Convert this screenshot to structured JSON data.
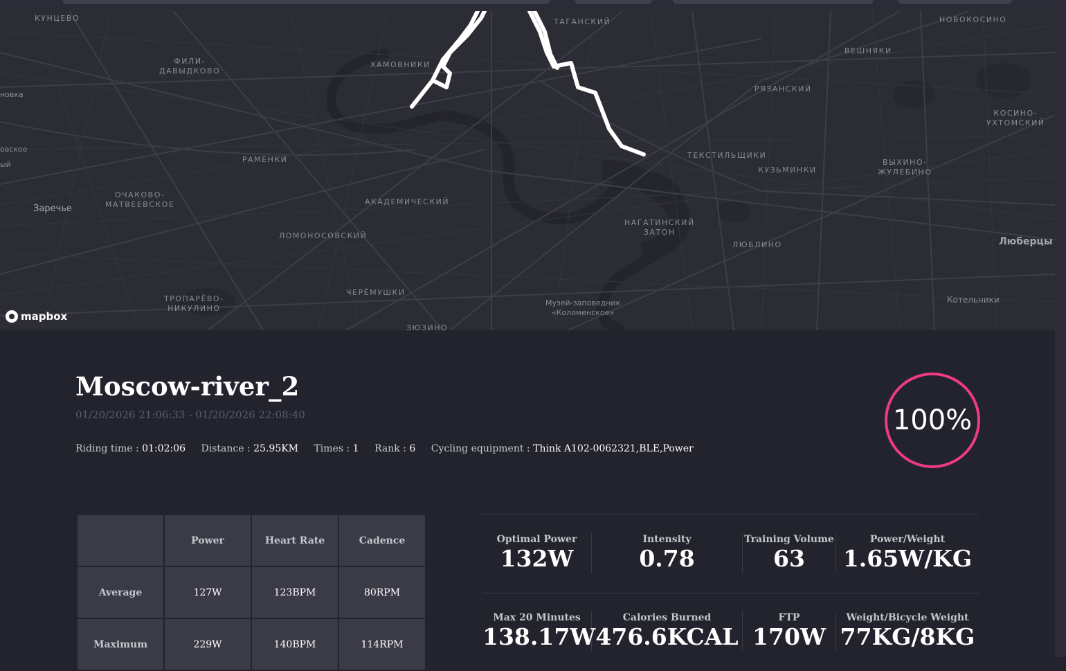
{
  "map": {
    "labels": [
      "КУНЦЕВО",
      "ФИЛИ-\nДАВЫДКОВО",
      "ХАМОВНИКИ",
      "ТАГАНСКИЙ",
      "НОВОКОСИНО",
      "ВЕШНЯКИ",
      "РЯЗАНСКИЙ",
      "КОСИНО-\nУХТОМСКИЙ",
      "ТЕКСТИЛЬЩИКИ",
      "КУЗЬМИНКИ",
      "ВЫХИНО-\nЖУЛЕБИНО",
      "РАМЕНКИ",
      "ОЧАКОВО-\nМАТВЕЕВСКОЕ",
      "Заречье",
      "АКАДЕМИЧЕСКИЙ",
      "ЛОМОНОСОВСКИЙ",
      "НАГАТИНСКИЙ\nЗАТОН",
      "ЛЮБЛИНО",
      "Люберцы",
      "ТРОПАРЁВО-\nНИКУЛИНО",
      "ЧЕРЁМУШКИ",
      "Музей-заповедник\n«Коломенское»",
      "Котельники",
      "ЗЮЗИНО",
      "новка",
      "овское",
      "ый"
    ],
    "attribution": "mapbox"
  },
  "ride": {
    "title": "Moscow-river_2",
    "date_range": "01/20/2026 21:06:33 - 01/20/2026 22:08:40",
    "riding_time_label": "Riding time : ",
    "riding_time": "01:02:06",
    "distance_label": "Distance : ",
    "distance": "25.95KM",
    "times_label": "Times : ",
    "times": "1",
    "rank_label": "Rank : ",
    "rank": "6",
    "equipment_label": "Cycling equipment : ",
    "equipment": "Think A102-0062321,BLE,Power",
    "completion": "100%"
  },
  "table": {
    "headers": [
      "",
      "Power",
      "Heart Rate",
      "Cadence"
    ],
    "rows": [
      {
        "label": "Average",
        "values": [
          "127W",
          "123BPM",
          "80RPM"
        ]
      },
      {
        "label": "Maximum",
        "values": [
          "229W",
          "140BPM",
          "114RPM"
        ]
      }
    ]
  },
  "metrics": [
    {
      "label": "Optimal Power",
      "value": "132W"
    },
    {
      "label": "Intensity",
      "value": "0.78"
    },
    {
      "label": "Training Volume",
      "value": "63"
    },
    {
      "label": "Power/Weight",
      "value": "1.65W/KG"
    },
    {
      "label": "Max 20 Minutes",
      "value": "138.17W"
    },
    {
      "label": "Calories Burned",
      "value": "476.6KCAL"
    },
    {
      "label": "FTP",
      "value": "170W"
    },
    {
      "label": "Weight/Bicycle Weight",
      "value": "77KG/8KG"
    }
  ],
  "colors": {
    "accent": "#ee3a87",
    "background": "#22232d",
    "map_bg": "#2c2c35",
    "route": "#ffffff"
  }
}
